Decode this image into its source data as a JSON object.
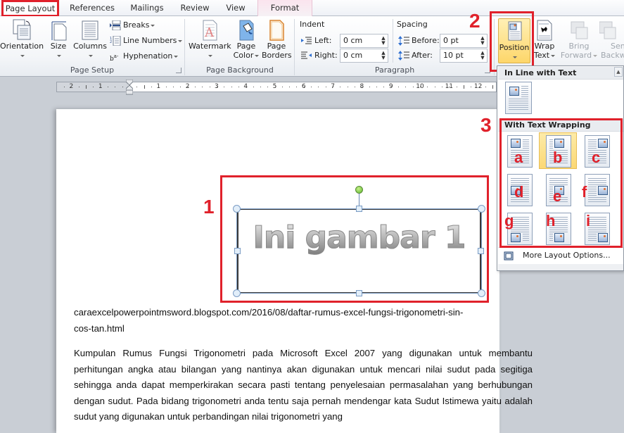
{
  "tabs": [
    {
      "label": "Page Layout",
      "active": true
    },
    {
      "label": "References"
    },
    {
      "label": "Mailings"
    },
    {
      "label": "Review"
    },
    {
      "label": "View"
    },
    {
      "label": "Format",
      "contextual": true
    }
  ],
  "ribbon": {
    "page_setup": {
      "label": "Page Setup",
      "orientation": "Orientation",
      "size": "Size",
      "columns": "Columns",
      "breaks": "Breaks",
      "line_numbers": "Line Numbers",
      "hyphenation": "Hyphenation"
    },
    "page_background": {
      "label": "Page Background",
      "watermark": "Watermark",
      "page_color_1": "Page",
      "page_color_2": "Color",
      "page_borders_1": "Page",
      "page_borders_2": "Borders"
    },
    "paragraph": {
      "label": "Paragraph",
      "indent_label": "Indent",
      "left_label": "Left:",
      "left_value": "0 cm",
      "right_label": "Right:",
      "right_value": "0 cm",
      "spacing_label": "Spacing",
      "before_label": "Before:",
      "before_value": "0 pt",
      "after_label": "After:",
      "after_value": "10 pt"
    },
    "arrange": {
      "position": "Position",
      "wrap_text_1": "Wrap",
      "wrap_text_2": "Text",
      "bring_forward_1": "Bring",
      "bring_forward_2": "Forward",
      "send_backward_1": "Send",
      "send_backward_2": "Backward"
    }
  },
  "ruler": {
    "left_ticks": [
      "2",
      "1"
    ],
    "right_ticks": [
      "1",
      "2",
      "3",
      "4",
      "5",
      "6",
      "7",
      "8",
      "9",
      "10",
      "11",
      "12"
    ]
  },
  "annotations": {
    "n1": "1",
    "n2": "2",
    "n3": "3",
    "letters": [
      "a",
      "b",
      "c",
      "d",
      "e",
      "f",
      "g",
      "h",
      "i"
    ]
  },
  "position_menu": {
    "inline_header": "In Line with Text",
    "wrapping_header": "With Text Wrapping",
    "selected_index": 1,
    "more_options": "More Layout Options..."
  },
  "document": {
    "image_text": "Ini gambar 1",
    "url_line_1": "caraexcelpowerpointmsword.blogspot.com/2016/08/daftar-rumus-excel-fungsi-trigonometri-sin-",
    "url_line_2": "cos-tan.html",
    "paragraph": "Kumpulan Rumus Fungsi Trigonometri pada Microsoft Excel 2007 yang digunakan untuk membantu perhitungan angka atau bilangan yang nantinya akan digunakan untuk mencari nilai sudut pada segitiga sehingga anda dapat memperkirakan secara pasti tentang penyelesaian permasalahan yang berhubungan dengan sudut. Pada bidang trigonometri anda tentu saja pernah mendengar kata Sudut Istimewa yaitu adalah sudut  yang digunakan untuk perbandingan nilai trigonometri yang"
  }
}
